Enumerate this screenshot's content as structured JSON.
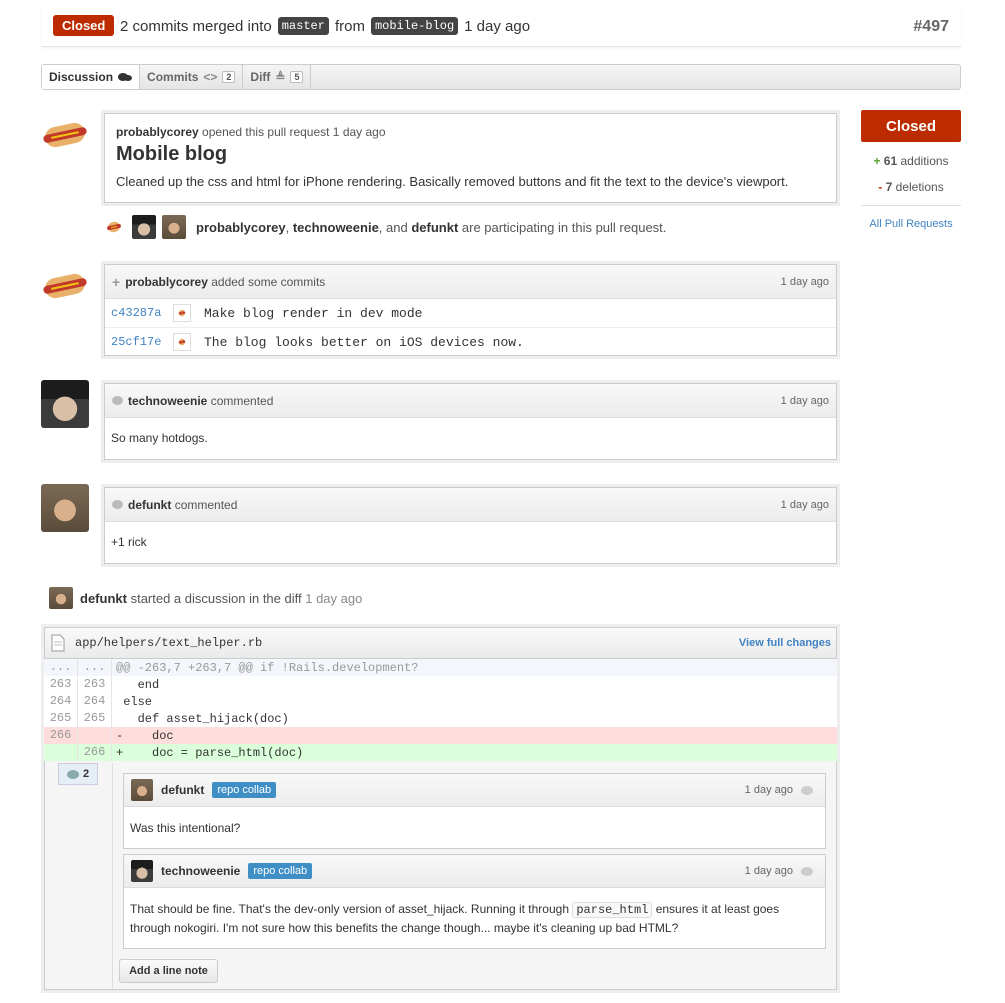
{
  "header": {
    "status": "Closed",
    "commits_text": "2 commits merged into",
    "base_branch": "master",
    "from_text": "from",
    "head_branch": "mobile-blog",
    "time": "1 day ago",
    "number": "#497"
  },
  "tabs": [
    {
      "label": "Discussion",
      "icon": "discussion-icon"
    },
    {
      "label": "Commits",
      "icon": "code-icon",
      "count": "2"
    },
    {
      "label": "Diff",
      "icon": "diff-icon",
      "count": "5"
    }
  ],
  "opened": {
    "author": "probablycorey",
    "action": "opened this pull request 1 day ago",
    "title": "Mobile blog",
    "body": "Cleaned up the css and html for iPhone rendering. Basically removed buttons and fit the text to the device's viewport."
  },
  "participants": {
    "names": [
      "probablycorey",
      "technoweenie",
      "defunkt"
    ],
    "sep1": ", ",
    "sep2": ", and ",
    "suffix": " are participating in this pull request."
  },
  "commits": {
    "author": "probablycorey",
    "action": "added some commits",
    "time": "1 day ago",
    "items": [
      {
        "sha": "c43287a",
        "message": "Make blog render in dev mode"
      },
      {
        "sha": "25cf17e",
        "message": "The blog looks better on iOS devices now."
      }
    ]
  },
  "comments": [
    {
      "author": "technoweenie",
      "action": "commented",
      "time": "1 day ago",
      "body": "So many hotdogs."
    },
    {
      "author": "defunkt",
      "action": "commented",
      "time": "1 day ago",
      "body": "+1 rick"
    }
  ],
  "discussion": {
    "author": "defunkt",
    "action": "started a discussion in the diff",
    "time": "1 day ago",
    "file": "app/helpers/text_helper.rb",
    "view_full": "View full changes",
    "lines": [
      {
        "old": "...",
        "new": "...",
        "text": "@@ -263,7 +263,7 @@ if !Rails.development?",
        "type": "hunk"
      },
      {
        "old": "263",
        "new": "263",
        "text": "   end",
        "type": "ctx"
      },
      {
        "old": "264",
        "new": "264",
        "text": " else",
        "type": "ctx"
      },
      {
        "old": "265",
        "new": "265",
        "text": "   def asset_hijack(doc)",
        "type": "ctx"
      },
      {
        "old": "266",
        "new": "",
        "text": "-    doc",
        "type": "del"
      },
      {
        "old": "",
        "new": "266",
        "text": "+    doc = parse_html(doc)",
        "type": "add"
      }
    ],
    "note_count": "2",
    "notes": [
      {
        "author": "defunkt",
        "badge": "repo collab",
        "time": "1 day ago",
        "body": "Was this intentional?"
      },
      {
        "author": "technoweenie",
        "badge": "repo collab",
        "time": "1 day ago",
        "body_pre": "That should be fine. That's the dev-only version of asset_hijack. Running it through ",
        "body_code": "parse_html",
        "body_post": " ensures it at least goes through nokogiri. I'm not sure how this benefits the change though... maybe it's cleaning up bad HTML?"
      }
    ],
    "add_note": "Add a line note"
  },
  "sidebar": {
    "status": "Closed",
    "additions_sign": "+",
    "additions": "61",
    "additions_label": "additions",
    "deletions_sign": "-",
    "deletions": "7",
    "deletions_label": "deletions",
    "all_prs": "All Pull Requests"
  },
  "colors": {
    "closed": "#bd2c00",
    "addition": "#55a532",
    "link": "#4183c4",
    "del_bg": "#ffdddd",
    "add_bg": "#dbffdb",
    "badge": "#3f8fc6"
  }
}
